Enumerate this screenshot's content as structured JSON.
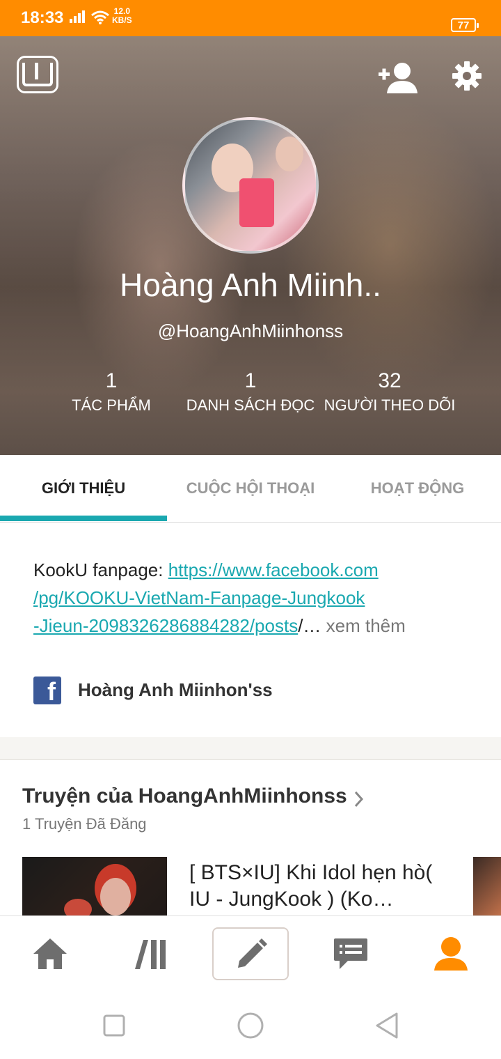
{
  "status_bar": {
    "time": "18:33",
    "speed_value": "12.0",
    "speed_unit": "KB/S",
    "battery": "77"
  },
  "profile": {
    "display_name": "Hoàng Anh Miinh..",
    "username": "@HoangAnhMiinhonss",
    "stats": [
      {
        "value": "1",
        "label": "TÁC PHẨM"
      },
      {
        "value": "1",
        "label": "DANH SÁCH ĐỌC"
      },
      {
        "value": "32",
        "label": "NGƯỜI THEO DÕI"
      }
    ]
  },
  "tabs": [
    {
      "label": "GIỚI THIỆU",
      "active": true
    },
    {
      "label": "CUỘC HỘI THOẠI",
      "active": false
    },
    {
      "label": "HOẠT ĐỘNG",
      "active": false
    }
  ],
  "about": {
    "bio_prefix": "KookU fanpage: ",
    "bio_link": "https://www.facebook.com/pg/KOOKU-VietNam-Fanpage-Jungkook-Jieun-2098326286884282/posts",
    "bio_link_line1": "https://www.facebook.com",
    "bio_link_line2": "/pg/KOOKU-VietNam-Fanpage-Jungkook",
    "bio_link_line3": "-Jieun-2098326286884282/posts",
    "bio_suffix": "/… ",
    "more_label": "xem thêm",
    "facebook_name": "Hoàng Anh Miinhon'ss"
  },
  "stories": {
    "title": "Truyện của HoangAnhMiinhonss",
    "subtitle": "1 Truyện Đã Đăng",
    "items": [
      {
        "title": "[ BTS×IU] Khi Idol hẹn hò( IU - JungKook ) (Ko…"
      }
    ]
  },
  "colors": {
    "status_bar": "#ff8c00",
    "accent": "#1aa8b0",
    "profile_active": "#ff8c00",
    "nav_icon": "#6e6e6e"
  },
  "icons": {
    "logo": "wattpad-logo-icon",
    "add_user": "add-user-icon",
    "settings": "gear-icon",
    "nav": [
      "home-icon",
      "library-icon",
      "pencil-icon",
      "chat-icon",
      "person-icon"
    ]
  }
}
